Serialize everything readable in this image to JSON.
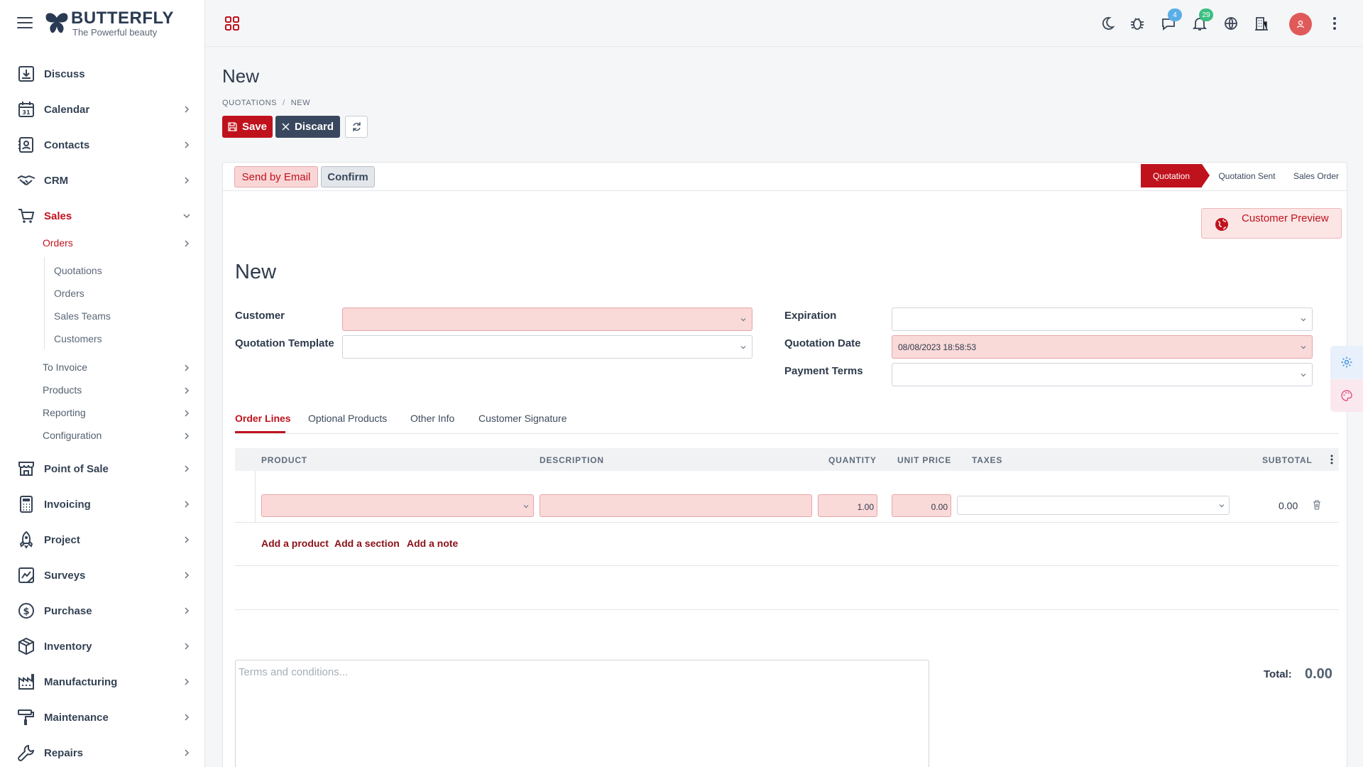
{
  "brand": {
    "name": "BUTTERFLY",
    "tagline": "The Powerful beauty"
  },
  "sidebar": {
    "items": [
      {
        "label": "Discuss",
        "icon": "download-tray-icon",
        "chevron": false
      },
      {
        "label": "Calendar",
        "icon": "calendar-icon",
        "chevron": true
      },
      {
        "label": "Contacts",
        "icon": "contacts-icon",
        "chevron": true
      },
      {
        "label": "CRM",
        "icon": "handshake-icon",
        "chevron": true
      },
      {
        "label": "Sales",
        "icon": "cart-icon",
        "chevron": true,
        "active": true
      },
      {
        "label": "Point of Sale",
        "icon": "store-icon",
        "chevron": true
      },
      {
        "label": "Invoicing",
        "icon": "calculator-icon",
        "chevron": true
      },
      {
        "label": "Project",
        "icon": "rocket-icon",
        "chevron": true
      },
      {
        "label": "Surveys",
        "icon": "survey-icon",
        "chevron": true
      },
      {
        "label": "Purchase",
        "icon": "dollar-circle-icon",
        "chevron": true
      },
      {
        "label": "Inventory",
        "icon": "box-icon",
        "chevron": true
      },
      {
        "label": "Manufacturing",
        "icon": "factory-icon",
        "chevron": true
      },
      {
        "label": "Maintenance",
        "icon": "paint-roller-icon",
        "chevron": true
      },
      {
        "label": "Repairs",
        "icon": "wrench-icon",
        "chevron": true
      }
    ],
    "sales_sub": {
      "orders": "Orders",
      "orders_children": [
        "Quotations",
        "Orders",
        "Sales Teams",
        "Customers"
      ],
      "others": [
        "To Invoice",
        "Products",
        "Reporting",
        "Configuration"
      ]
    }
  },
  "topbar": {
    "messages_badge": "4",
    "notifications_badge": "29",
    "icons": [
      "moon-icon",
      "bug-icon",
      "chat-icon",
      "bell-icon",
      "globe-icon",
      "building-icon",
      "avatar",
      "kebab-icon"
    ]
  },
  "page": {
    "title": "New",
    "breadcrumb": [
      "QUOTATIONS",
      "NEW"
    ],
    "save_label": "Save",
    "discard_label": "Discard"
  },
  "form": {
    "send_email_label": "Send by Email",
    "confirm_label": "Confirm",
    "stages": [
      "Quotation",
      "Quotation Sent",
      "Sales Order"
    ],
    "active_stage": "Quotation",
    "preview_label": "Customer Preview",
    "record_title": "New",
    "fields_left": [
      {
        "label": "Customer",
        "value": "",
        "required": true
      },
      {
        "label": "Quotation Template",
        "value": "",
        "required": false
      }
    ],
    "fields_right": [
      {
        "label": "Expiration",
        "value": "",
        "required": false
      },
      {
        "label": "Quotation Date",
        "value": "08/08/2023 18:58:53",
        "required": true
      },
      {
        "label": "Payment Terms",
        "value": "",
        "required": false
      }
    ],
    "tabs": [
      "Order Lines",
      "Optional Products",
      "Other Info",
      "Customer Signature"
    ],
    "active_tab": "Order Lines",
    "columns": [
      "PRODUCT",
      "DESCRIPTION",
      "QUANTITY",
      "UNIT PRICE",
      "TAXES",
      "SUBTOTAL"
    ],
    "line": {
      "quantity": "1.00",
      "unit_price": "0.00",
      "subtotal": "0.00"
    },
    "add_links": [
      "Add a product",
      "Add a section",
      "Add a note"
    ],
    "terms_placeholder": "Terms and conditions...",
    "total_label": "Total:",
    "total_value": "0.00"
  },
  "colors": {
    "accent": "#c0121d",
    "dark": "#39485e",
    "required_bg": "#fad9d9"
  }
}
